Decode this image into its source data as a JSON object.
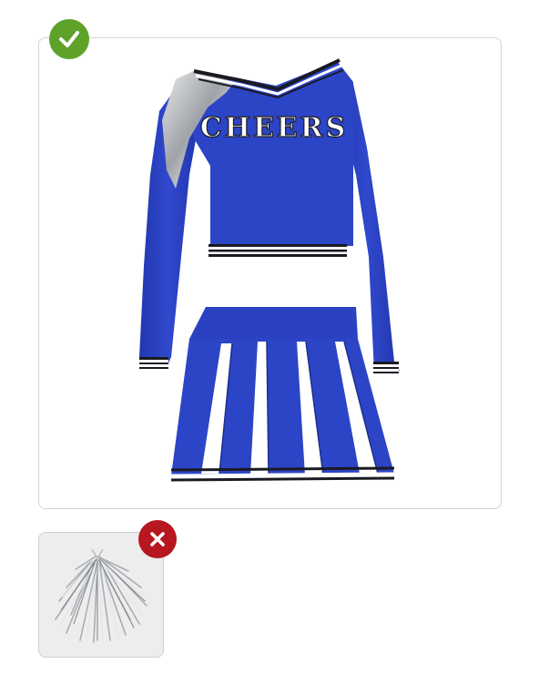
{
  "options": [
    {
      "name": "cheerleader-uniform",
      "status": "correct",
      "status_icon": "check-icon",
      "status_color": "#5ea22a",
      "garment_text": "CHEERS",
      "colors": {
        "primary": "#2c45c6",
        "accent": "#bfc2c6",
        "trim": "#1a1a22"
      }
    },
    {
      "name": "silver-pom-pom",
      "status": "incorrect",
      "status_icon": "x-icon",
      "status_color": "#b7171f"
    }
  ]
}
